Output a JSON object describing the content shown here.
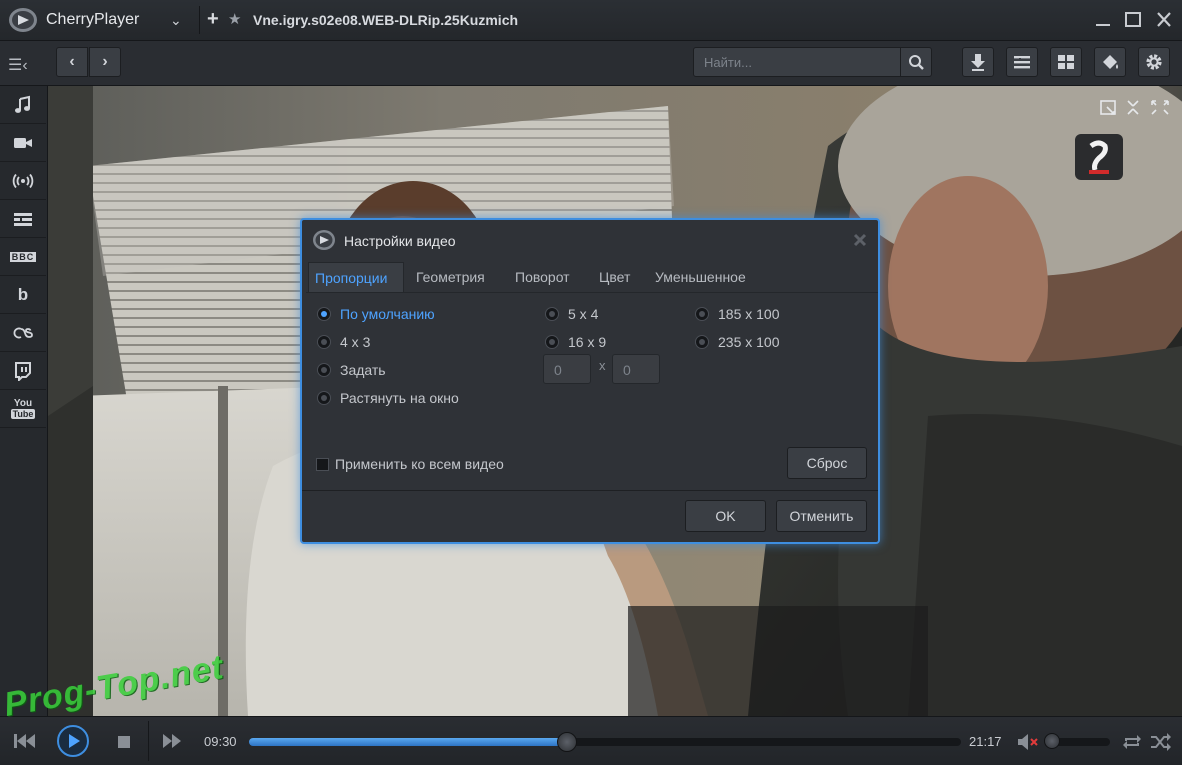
{
  "app": {
    "title": "CherryPlayer",
    "file_title": "Vne.igry.s02e08.WEB-DLRip.25Kuzmich"
  },
  "toolbar": {
    "search_placeholder": "Найти..."
  },
  "sidebar": {
    "items": [
      {
        "icon": "music-note-icon"
      },
      {
        "icon": "video-camera-icon"
      },
      {
        "icon": "broadcast-icon"
      },
      {
        "icon": "tv-guide-icon"
      },
      {
        "icon": "bbc-icon",
        "text": "BBC"
      },
      {
        "icon": "bandcamp-icon",
        "text": "b"
      },
      {
        "icon": "lastfm-icon",
        "text": "∞"
      },
      {
        "icon": "twitch-icon"
      },
      {
        "icon": "youtube-icon",
        "text_top": "You",
        "text_bottom": "Tube"
      }
    ]
  },
  "dialog": {
    "title": "Настройки видео",
    "tabs": [
      "Пропорции",
      "Геометрия",
      "Поворот",
      "Цвет",
      "Уменьшенное"
    ],
    "active_tab": "Пропорции",
    "options_col1": [
      "По умолчанию",
      "4 x 3",
      "Задать",
      "Растянуть на окно"
    ],
    "options_col2": [
      "5 x 4",
      "16 x 9"
    ],
    "options_col3": [
      "185 x 100",
      "235 x 100"
    ],
    "selected_option": "По умолчанию",
    "custom_width": "0",
    "custom_height": "0",
    "custom_sep": "x",
    "apply_all_label": "Применить ко всем видео",
    "apply_all_checked": false,
    "reset_label": "Сброс",
    "ok_label": "OK",
    "cancel_label": "Отменить"
  },
  "player": {
    "current_time": "09:30",
    "total_time": "21:17",
    "progress": 0.446,
    "volume": 0.1,
    "muted": true
  },
  "watermark": "Prog-Top.net",
  "colors": {
    "accent": "#3e8ee0",
    "selected_text": "#4ea3ff",
    "mute_x": "#e23b3b",
    "watermark": "#39d13a"
  }
}
